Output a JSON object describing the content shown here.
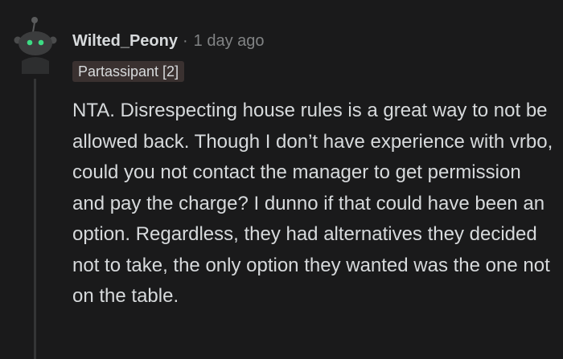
{
  "comment": {
    "author": "Wilted_Peony",
    "separator": "·",
    "timestamp": "1 day ago",
    "flair": "Partassipant [2]",
    "body": "NTA. Disrespecting house rules is a great way to not be allowed back. Though I don’t have experience with vrbo, could you not contact the manager to get permission and pay the charge? I dunno if that could have been an option. Regardless, they had alternatives they decided not to take, the only option they wanted was the one not on the table.",
    "avatar_icon": "snoo-avatar-icon"
  },
  "colors": {
    "background": "#1a1a1b",
    "text": "#d7dadc",
    "meta": "#818384",
    "flair_bg": "#3a3130",
    "thread_line": "#343536",
    "avatar_eyes": "#3ddc84"
  }
}
